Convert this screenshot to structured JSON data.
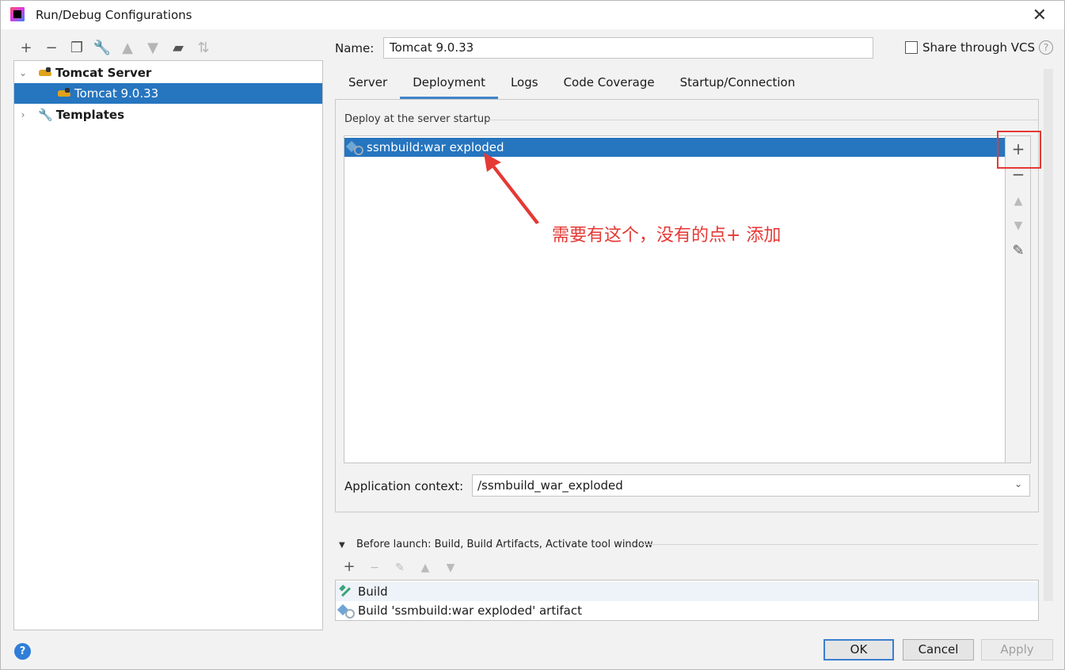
{
  "window": {
    "title": "Run/Debug Configurations"
  },
  "left_toolbar": {
    "icons": [
      "add-icon",
      "remove-icon",
      "copy-icon",
      "wrench-icon",
      "move-up-icon",
      "move-down-icon",
      "folder-add-icon",
      "sort-icon"
    ]
  },
  "tree": {
    "items": [
      {
        "label": "Tomcat Server",
        "expanded": true
      },
      {
        "label": "Tomcat 9.0.33",
        "selected": true
      },
      {
        "label": "Templates",
        "expanded": false
      }
    ]
  },
  "name": {
    "label": "Name:",
    "value": "Tomcat 9.0.33"
  },
  "share": {
    "label": "Share through VCS",
    "checked": false
  },
  "tabs": [
    {
      "label": "Server"
    },
    {
      "label": "Deployment",
      "active": true
    },
    {
      "label": "Logs"
    },
    {
      "label": "Code Coverage"
    },
    {
      "label": "Startup/Connection"
    }
  ],
  "deployment": {
    "section_label": "Deploy at the server startup",
    "items": [
      {
        "label": "ssmbuild:war exploded",
        "selected": true
      }
    ],
    "annotation": "需要有这个，没有的点+ 添加",
    "context_label": "Application context:",
    "context_value": "/ssmbuild_war_exploded"
  },
  "before_launch": {
    "label": "Before launch: Build, Build Artifacts, Activate tool window",
    "items": [
      {
        "label": "Build"
      },
      {
        "label": "Build 'ssmbuild:war exploded' artifact"
      }
    ]
  },
  "buttons": {
    "ok": "OK",
    "cancel": "Cancel",
    "apply": "Apply",
    "help": "?"
  },
  "colors": {
    "selection": "#2675bf",
    "annotation": "#e53935",
    "accent": "#4083c9"
  }
}
